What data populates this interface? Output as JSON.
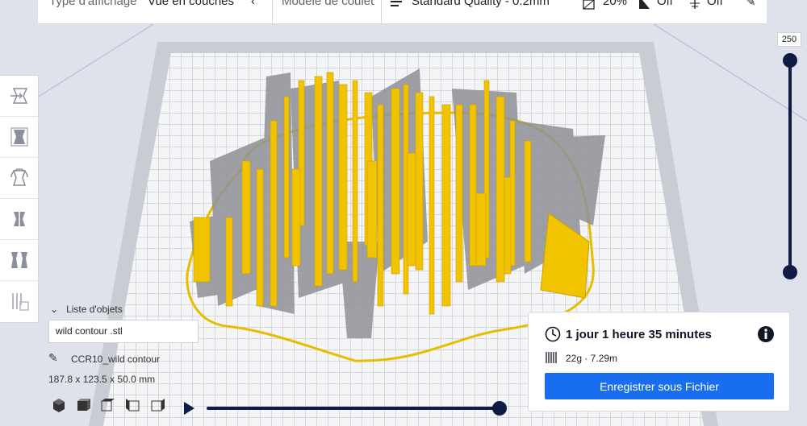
{
  "topbar": {
    "view_type_label": "Type d'affichage",
    "view_type_value": "Vue en couches",
    "color_scheme_label": "Modèle de couleur",
    "profile": "Standard Quality - 0.2mm",
    "infill": "20%",
    "support": "Off",
    "adhesion": "Off"
  },
  "objects": {
    "header": "Liste d'objets",
    "file": "wild contour .stl",
    "object_name": "CCR10_wild contour",
    "dimensions": "187.8 x 123.5 x 50.0 mm"
  },
  "layer": {
    "max": "250"
  },
  "print": {
    "time": "1 jour 1 heure 35 minutes",
    "material": "22g · 7.29m",
    "save_label": "Enregistrer sous Fichier"
  },
  "colors": {
    "accent": "#196ef0",
    "model": "#f2c300",
    "slider": "#0f1b45"
  }
}
